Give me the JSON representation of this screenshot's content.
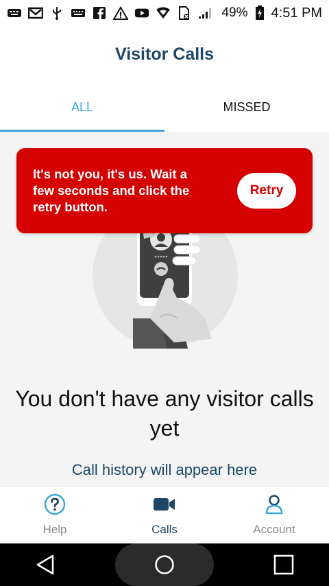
{
  "status_bar": {
    "battery": "49%",
    "time": "4:51 PM",
    "icons": [
      "keyboard-icon",
      "gmail-icon",
      "usb-icon",
      "keyboard-icon",
      "facebook-icon",
      "warning-icon",
      "youtube-icon",
      "wifi-icon",
      "no-sim-icon",
      "signal-icon",
      "battery-charging-icon"
    ]
  },
  "header": {
    "title": "Visitor Calls"
  },
  "tabs": [
    {
      "label": "ALL",
      "active": true
    },
    {
      "label": "MISSED",
      "active": false
    }
  ],
  "error_banner": {
    "message": "It's not you, it's us. Wait a few seconds and click the retry button.",
    "retry_label": "Retry"
  },
  "empty_state": {
    "title": "You don't have any visitor calls yet",
    "subtitle": "Call history will appear here"
  },
  "bottom_nav": {
    "items": [
      {
        "label": "Help",
        "icon": "help-icon",
        "active": false
      },
      {
        "label": "Calls",
        "icon": "video-camera-icon",
        "active": true
      },
      {
        "label": "Account",
        "icon": "account-icon",
        "active": false
      }
    ]
  },
  "colors": {
    "accent": "#3aa7df",
    "navy": "#1d4766",
    "error": "#d50000",
    "content_bg": "#f4f4f4"
  }
}
